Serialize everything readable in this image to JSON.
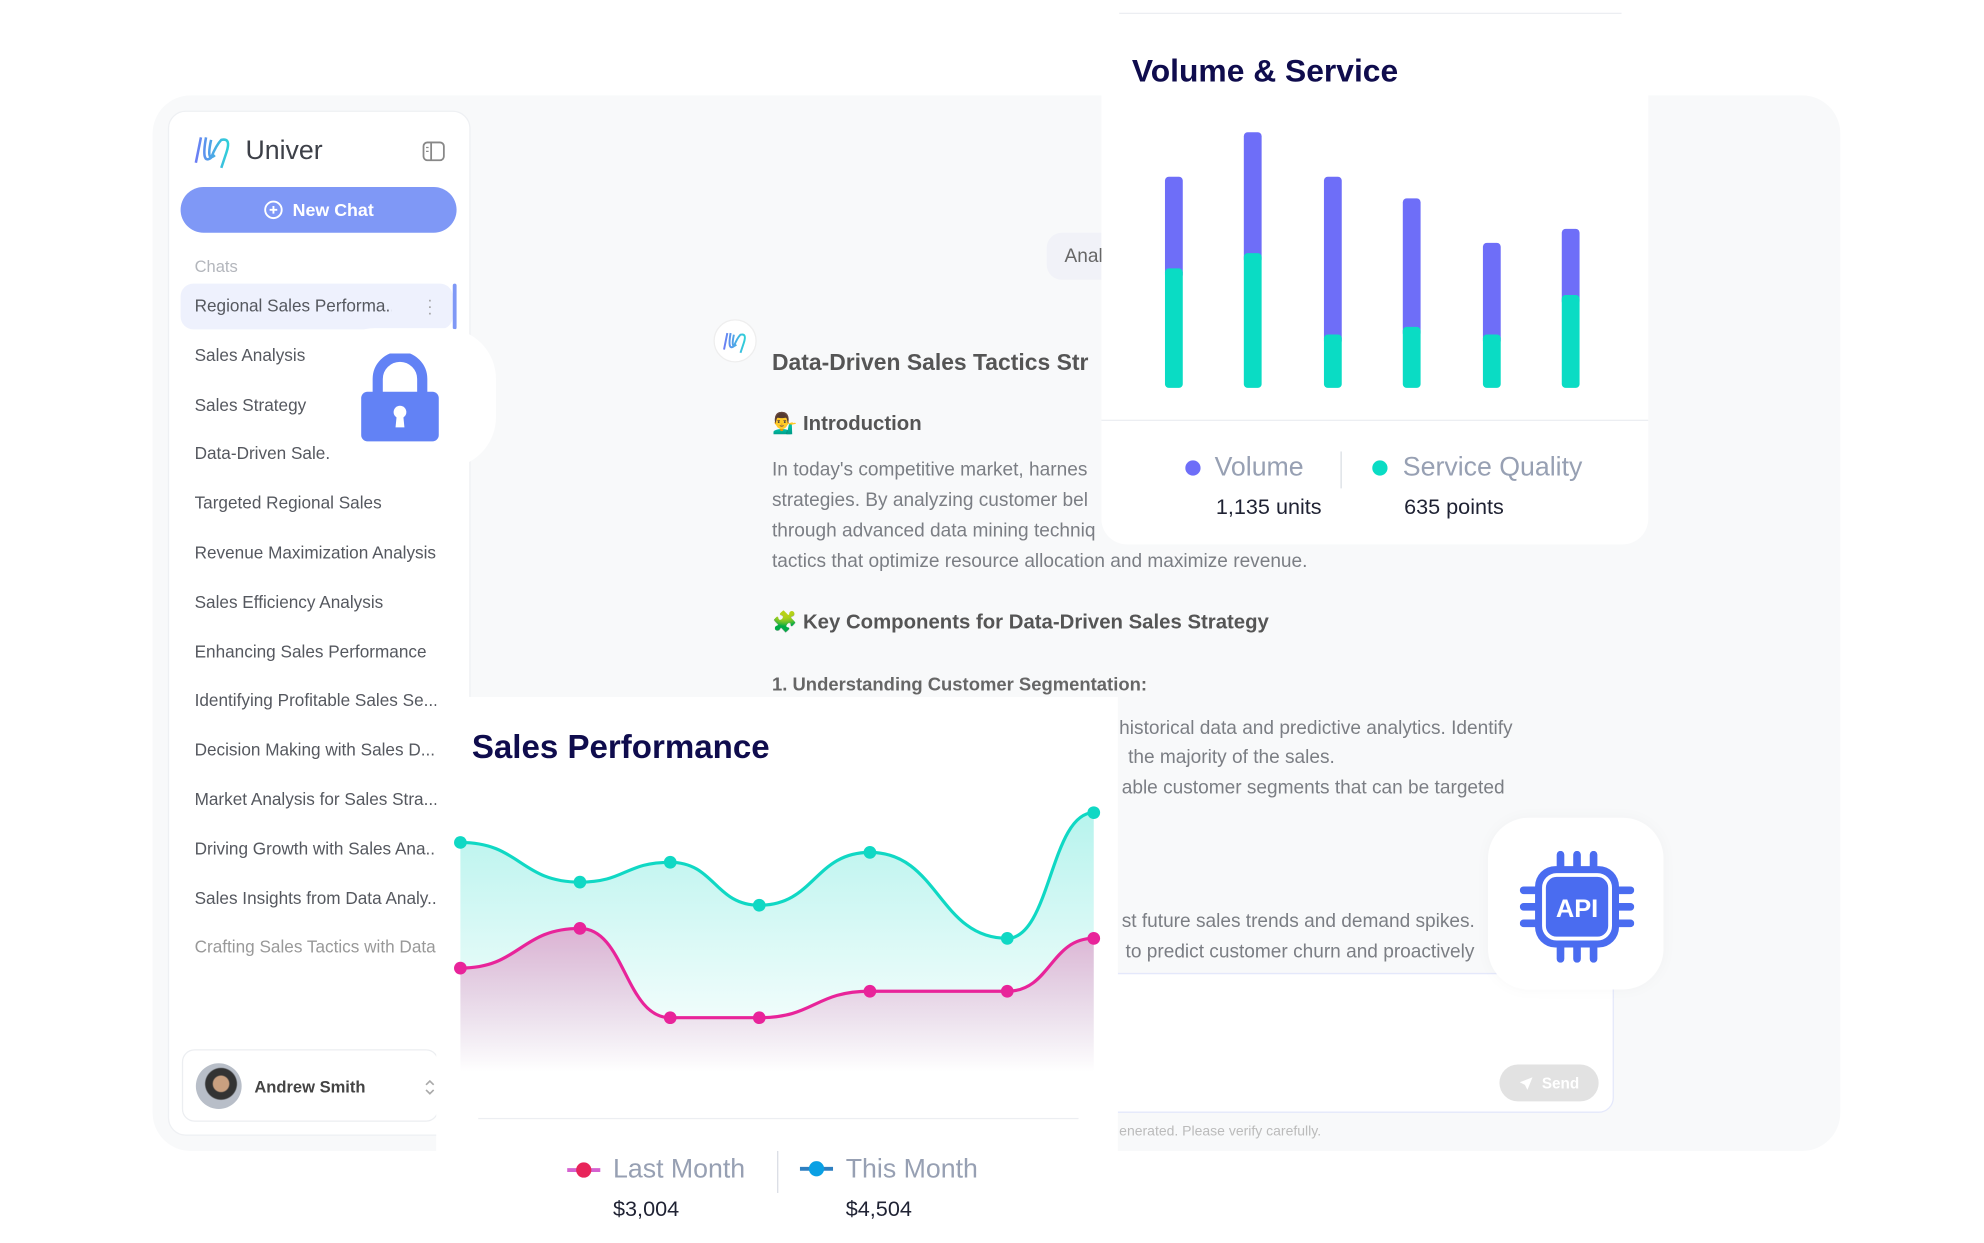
{
  "sidebar": {
    "brand": "Univer",
    "new_chat": "New Chat",
    "chats_label": "Chats",
    "items": [
      "Regional Sales Performa...",
      "Sales Analysis",
      "Sales Strategy",
      "Data-Driven Sale.",
      "Targeted Regional Sales",
      "Revenue Maximization Analysis",
      "Sales Efficiency Analysis",
      "Enhancing Sales Performance",
      "Identifying Profitable Sales Se...",
      "Decision Making with Sales D...",
      "Market Analysis for Sales Stra...",
      "Driving Growth with Sales Ana...",
      "Sales Insights from Data Analy...",
      "Crafting Sales Tactics with Data"
    ],
    "user_name": "Andrew Smith"
  },
  "chat": {
    "pill": "Anal",
    "title": "Data-Driven Sales Tactics Str",
    "intro_emoji": "💁‍♂️",
    "intro": "Introduction",
    "intro_lines": [
      "In today's competitive market, harnes",
      "strategies. By analyzing customer bel",
      "through advanced data mining techniq",
      "tactics that optimize resource allocation and maximize revenue."
    ],
    "key_emoji": "🧩",
    "key": "Key Components for Data-Driven Sales Strategy",
    "sub1": "1. Understanding Customer Segmentation:",
    "lines_a": [
      "historical data and predictive analytics. Identify",
      "the majority of the sales.",
      "able customer segments that can be targeted"
    ],
    "lines_b": [
      "st future sales trends and demand spikes.",
      "to predict customer churn and proactively"
    ],
    "send": "Send",
    "disclaimer": "enerated. Please verify carefully."
  },
  "api_label": "API",
  "colors": {
    "accent": "#7f98f6",
    "volume": "#6e6ef8",
    "service": "#0adcc4",
    "last_month": "#e8249a",
    "this_month": "#10d8c4"
  },
  "chart_data": [
    {
      "type": "bar",
      "stacked": true,
      "title": "Volume & Service",
      "series": [
        {
          "name": "Service Quality",
          "values": [
            94,
            106,
            42,
            48,
            42,
            73
          ]
        },
        {
          "name": "Volume",
          "values": [
            72,
            95,
            124,
            101,
            72,
            52
          ]
        }
      ],
      "legend": [
        {
          "label": "Volume",
          "value": "1,135 units"
        },
        {
          "label": "Service Quality",
          "value": "635 points"
        }
      ],
      "grid": false,
      "legend_position": "bottom"
    },
    {
      "type": "area",
      "title": "Sales Performance",
      "series": [
        {
          "name": "This Month",
          "values": [
            76,
            64,
            70,
            57,
            73,
            47,
            85
          ]
        },
        {
          "name": "Last Month",
          "values": [
            38,
            50,
            23,
            23,
            31,
            31,
            47
          ]
        }
      ],
      "legend": [
        {
          "label": "Last Month",
          "value": "$3,004"
        },
        {
          "label": "This Month",
          "value": "$4,504"
        }
      ],
      "grid": false,
      "legend_position": "bottom"
    }
  ]
}
